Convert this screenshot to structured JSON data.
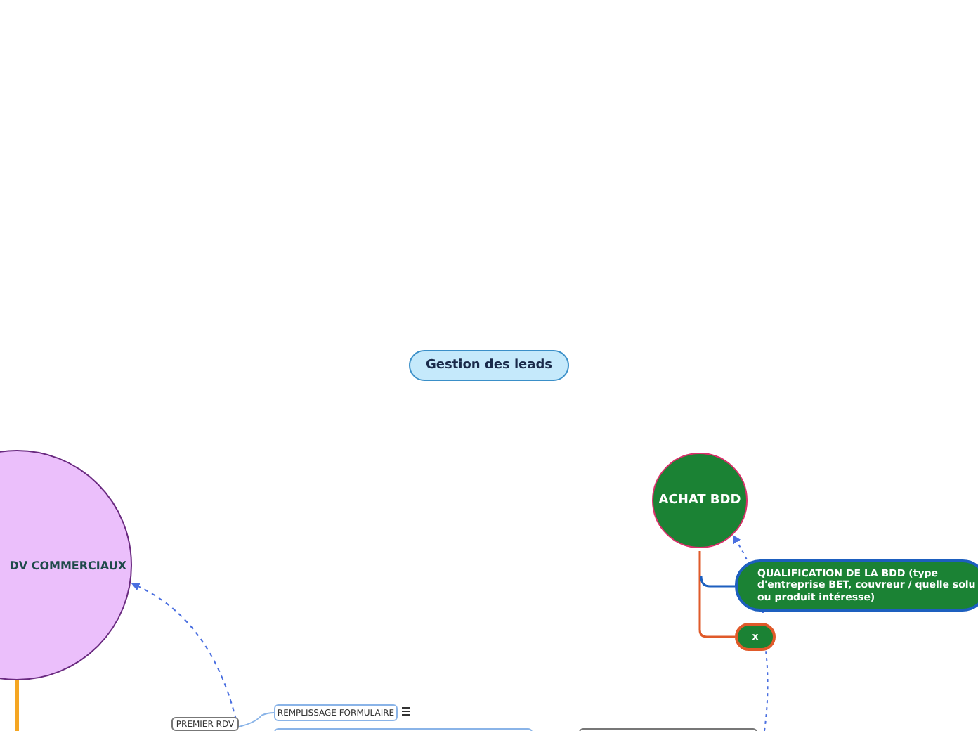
{
  "root": {
    "label": "Gestion des leads"
  },
  "topics": [
    {
      "kind": "circle",
      "label": "DV COMMERCIAUX",
      "color": "#ebbffb"
    },
    {
      "kind": "circle",
      "label": "ACHAT BDD",
      "color": "#1b8234"
    }
  ],
  "achat_children": [
    {
      "lines": [
        "QUALIFICATION DE LA BDD (type",
        "d'entreprise BET, couvreur / quelle solu",
        "ou produit intéresse)"
      ],
      "color": "#1d5fbf"
    },
    {
      "lines": [
        "x"
      ],
      "color": "#e05a2a"
    }
  ],
  "rdv_children": [
    {
      "label": "PREMIER RDV",
      "children": [
        {
          "label": "REMPLISSAGE FORMULAIRE",
          "has_notes": true
        }
      ]
    }
  ]
}
